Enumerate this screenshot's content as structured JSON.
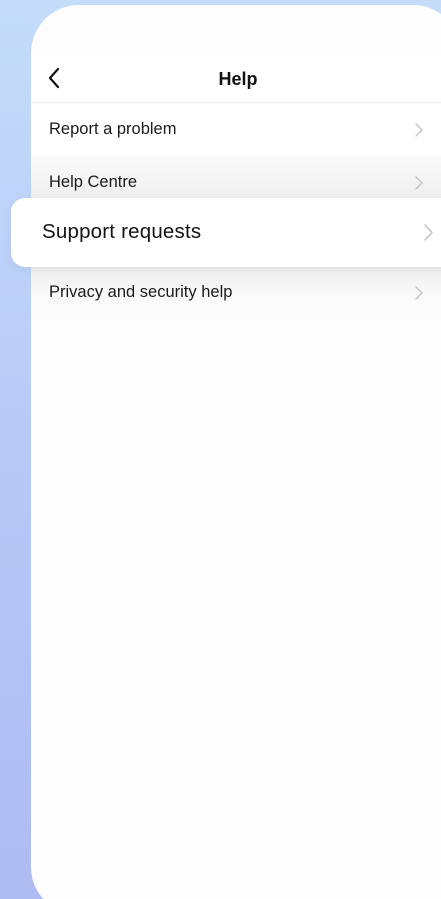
{
  "header": {
    "title": "Help",
    "back_icon": "chevron-left-icon"
  },
  "menu": {
    "items": [
      {
        "label": "Report a problem",
        "icon": "chevron-right-icon"
      },
      {
        "label": "Help Centre",
        "icon": "chevron-right-icon"
      },
      {
        "label": "Support requests",
        "icon": "chevron-right-icon",
        "highlighted": true
      },
      {
        "label": "Privacy and security help",
        "icon": "chevron-right-icon"
      }
    ]
  },
  "colors": {
    "background_top": "#c4dcfa",
    "background_bottom": "#aebbf2",
    "screen": "#fdfdfd",
    "text": "#1b1b1b",
    "chevron": "#c2c2c2"
  }
}
